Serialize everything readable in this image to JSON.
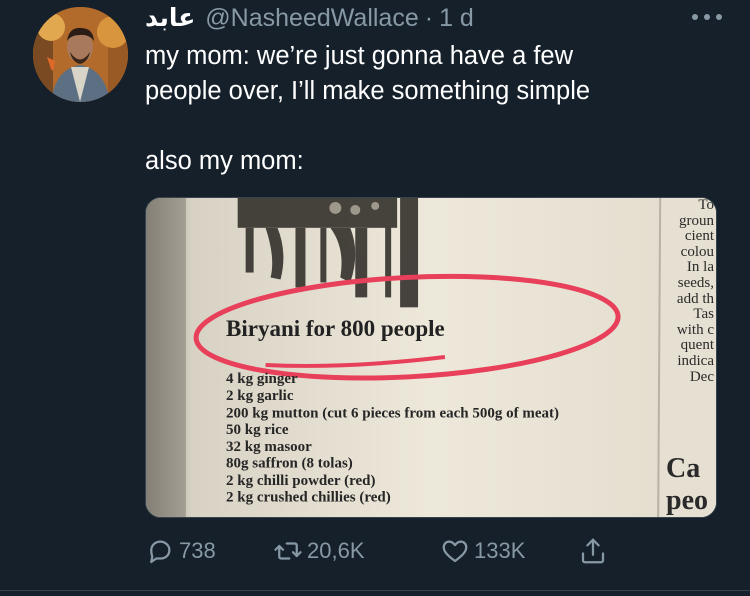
{
  "user": {
    "display_name": "عابد",
    "handle": "@NasheedWallace",
    "separator": "·",
    "time": "1 d"
  },
  "tweet": {
    "line1": "my mom: we’re just gonna have a few",
    "line2": "people over, I’ll make something simple",
    "line3": "also my mom:"
  },
  "media": {
    "title": "Biryani for 800 people",
    "ingredients": [
      "4 kg ginger",
      "2 kg garlic",
      "200 kg mutton (cut 6 pieces from each 500g of meat)",
      "50 kg rice",
      "32 kg masoor",
      "80g saffron (8 tolas)",
      "2 kg chilli powder (red)",
      "2 kg crushed chillies (red)"
    ],
    "right_column": [
      "To",
      "groun",
      "cient",
      "colou",
      "In la",
      "seeds,",
      "add th",
      "Tas",
      "with c",
      "quent",
      "indica",
      "Dec"
    ],
    "right_big": [
      "Ca",
      "peo"
    ],
    "circle_color": "#e8405a"
  },
  "actions": {
    "reply_count": "738",
    "retweet_count": "20,6K",
    "like_count": "133K"
  },
  "colors": {
    "background": "#15202b",
    "secondary_text": "#8899a6",
    "divider": "#38444d"
  }
}
